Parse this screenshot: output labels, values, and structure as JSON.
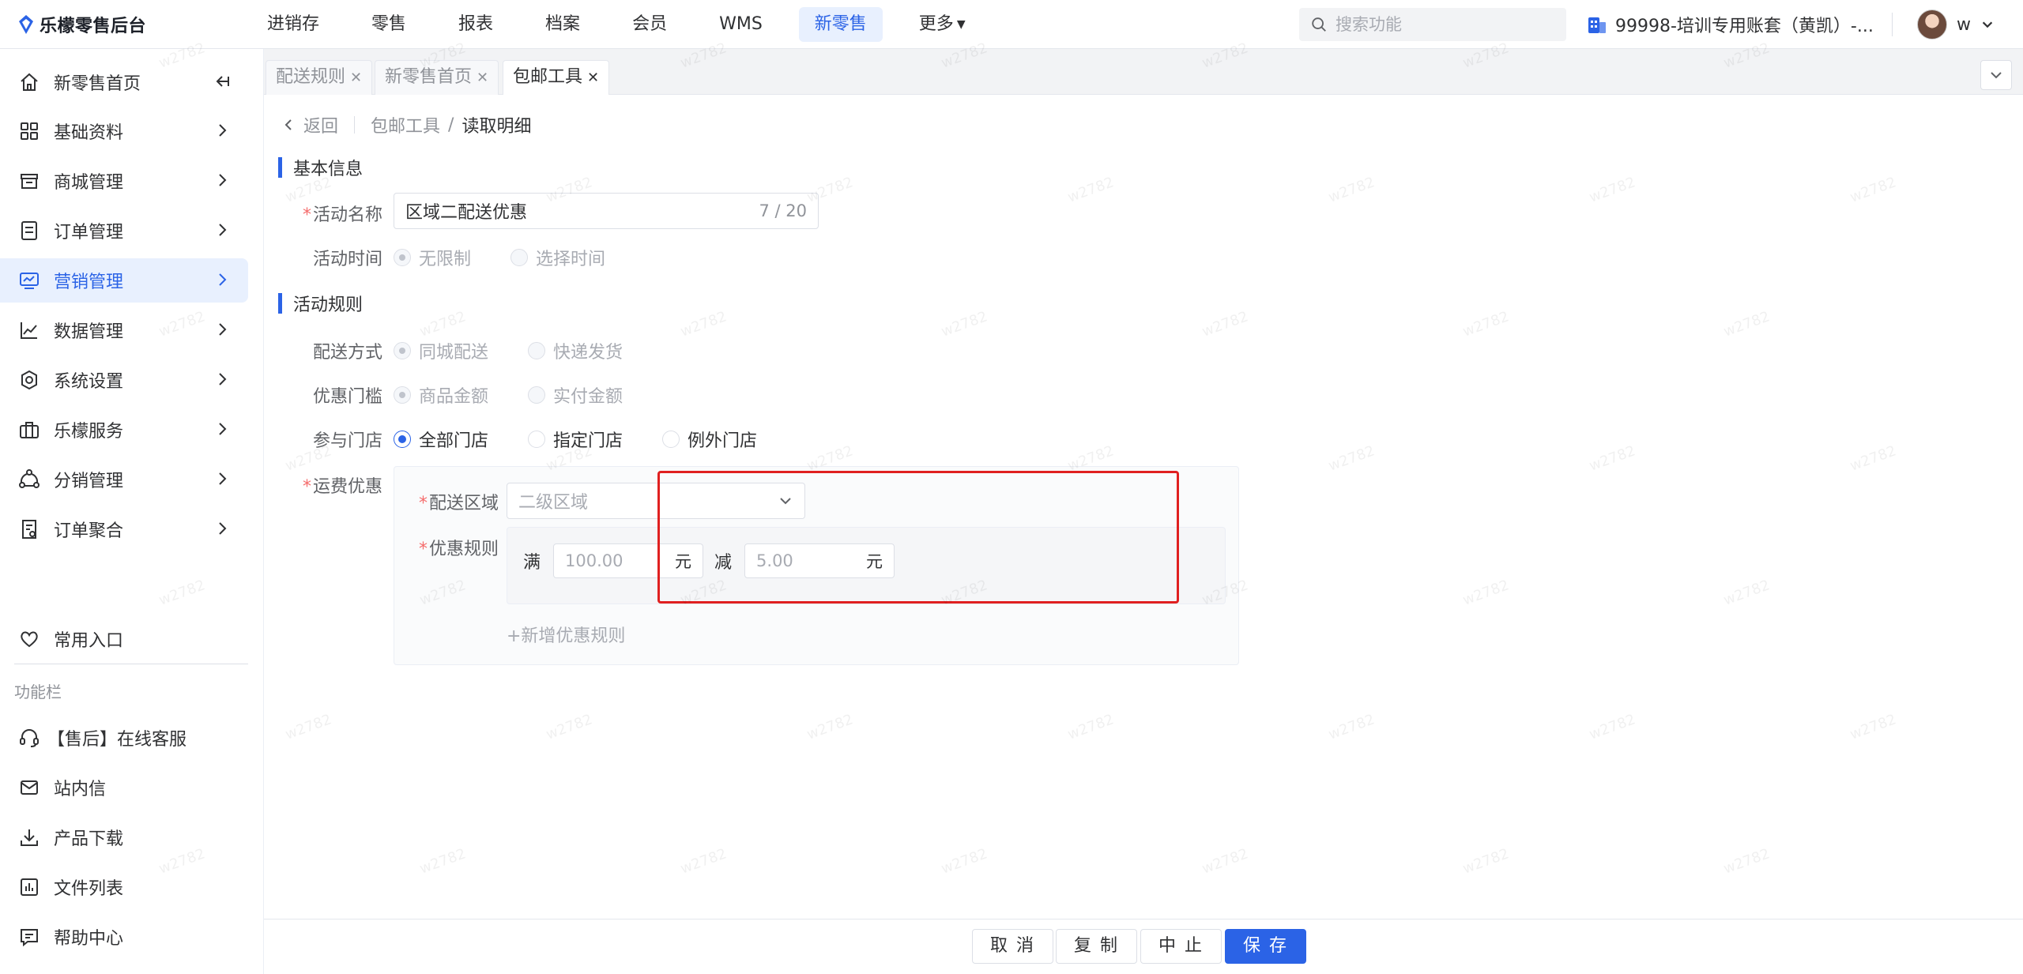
{
  "app": {
    "logo_text": "乐檬零售后台",
    "top_nav": [
      {
        "label": "进销存"
      },
      {
        "label": "零售"
      },
      {
        "label": "报表"
      },
      {
        "label": "档案"
      },
      {
        "label": "会员"
      },
      {
        "label": "WMS"
      },
      {
        "label": "新零售",
        "active": true
      },
      {
        "label": "更多"
      }
    ],
    "search_placeholder": "搜索功能",
    "account_label": "99998-培训专用账套（黄凯）-...",
    "user_name": "w",
    "accent_color": "#2b63e6"
  },
  "sidebar": {
    "items": [
      {
        "label": "新零售首页",
        "icon": "home-icon"
      },
      {
        "label": "基础资料",
        "icon": "grid-icon"
      },
      {
        "label": "商城管理",
        "icon": "store-icon"
      },
      {
        "label": "订单管理",
        "icon": "order-icon"
      },
      {
        "label": "营销管理",
        "icon": "monitor-icon",
        "active": true
      },
      {
        "label": "数据管理",
        "icon": "chart-icon"
      },
      {
        "label": "系统设置",
        "icon": "settings-icon"
      },
      {
        "label": "乐檬服务",
        "icon": "briefcase-icon"
      },
      {
        "label": "分销管理",
        "icon": "network-icon"
      },
      {
        "label": "订单聚合",
        "icon": "document-icon"
      }
    ],
    "favorites_label": "常用入口",
    "section_title": "功能栏",
    "tools": [
      {
        "label": "【售后】在线客服",
        "icon": "headset-icon"
      },
      {
        "label": "站内信",
        "icon": "mail-icon"
      },
      {
        "label": "产品下载",
        "icon": "download-icon"
      },
      {
        "label": "文件列表",
        "icon": "file-list-icon"
      },
      {
        "label": "帮助中心",
        "icon": "help-icon"
      }
    ]
  },
  "tabs": [
    {
      "label": "配送规则"
    },
    {
      "label": "新零售首页"
    },
    {
      "label": "包邮工具",
      "active": true
    }
  ],
  "breadcrumb": {
    "back": "返回",
    "parent": "包邮工具",
    "separator": "/",
    "current": "读取明细"
  },
  "basic_info": {
    "title": "基本信息",
    "name_label": "活动名称",
    "name_value": "区域二配送优惠",
    "name_count": "7 / 20",
    "time_label": "活动时间",
    "time_options": [
      "无限制",
      "选择时间"
    ]
  },
  "rules": {
    "title": "活动规则",
    "delivery_label": "配送方式",
    "delivery_options": [
      "同城配送",
      "快递发货"
    ],
    "threshold_label": "优惠门槛",
    "threshold_options": [
      "商品金额",
      "实付金额"
    ],
    "stores_label": "参与门店",
    "stores_options": [
      "全部门店",
      "指定门店",
      "例外门店"
    ],
    "freight_label": "运费优惠",
    "region_label": "配送区域",
    "region_value": "二级区域",
    "discount_rule_label": "优惠规则",
    "full_label": "满",
    "full_value": "100.00",
    "reduce_label": "减",
    "reduce_value": "5.00",
    "unit": "元",
    "add_rule": "+新增优惠规则"
  },
  "footer": {
    "cancel": "取 消",
    "copy": "复 制",
    "stop": "中 止",
    "save": "保 存"
  },
  "watermark": "w2782"
}
